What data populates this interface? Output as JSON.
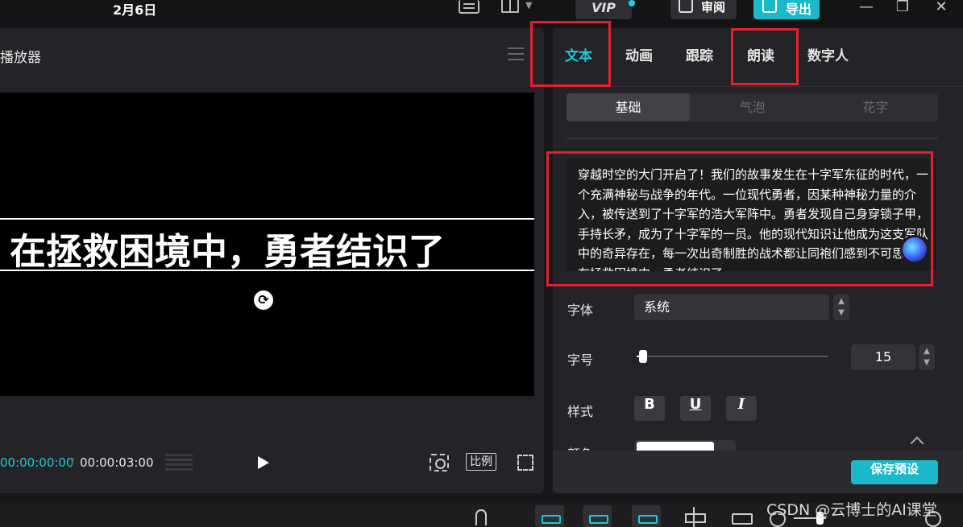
{
  "app": {
    "date": "2月6日"
  },
  "toolbar": {
    "vip_label": "VIP",
    "review_label": "审阅",
    "export_label": "导出"
  },
  "player": {
    "title": "播放器",
    "subtitle": "在拯救困境中，勇者结识了",
    "current_time": "00:00:00:00",
    "time_separator": "/",
    "total_time": "00:00:03:00",
    "ratio_label": "比例"
  },
  "panel": {
    "tabs": [
      {
        "label": "文本",
        "active": true
      },
      {
        "label": "动画",
        "active": false
      },
      {
        "label": "跟踪",
        "active": false
      },
      {
        "label": "朗读",
        "active": false
      },
      {
        "label": "数字人",
        "active": false
      }
    ],
    "segments": [
      {
        "label": "基础",
        "active": true
      },
      {
        "label": "气泡",
        "active": false
      },
      {
        "label": "花字",
        "active": false
      }
    ],
    "text_content": " 穿越时空的大门开启了！我们的故事发生在十字军东征的时代，一个充满神秘与战争的年代。一位现代勇者，因某种神秘力量的介入，被传送到了十字军的浩大军阵中。勇者发现自己身穿锁子甲，手持长矛，成为了十字军的一员。他的现代知识让他成为这支军队中的奇异存在，每一次出奇制胜的战术都让同袍们感到不可思议。在拯救困境中，勇者结识了",
    "font_label": "字体",
    "font_value": "系统",
    "size_label": "字号",
    "size_value": "15",
    "size_slider_level": 0.05,
    "style_label": "样式",
    "style_buttons": {
      "bold": "B",
      "underline": "U",
      "italic": "I"
    },
    "color_label": "颜色",
    "save_preset_label": "保存预设"
  },
  "watermark": "CSDN @云博士的AI课堂",
  "colors": {
    "accent": "#1fc8d8",
    "highlight": "#e5202d",
    "background": "#18181b",
    "panel": "#242428"
  }
}
